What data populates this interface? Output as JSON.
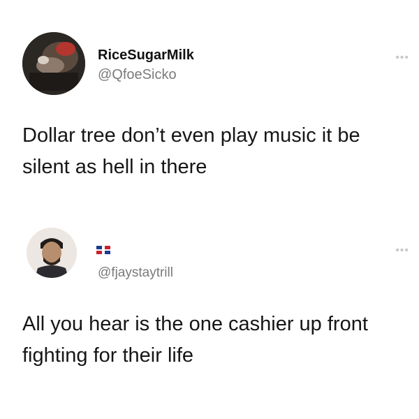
{
  "tweets": [
    {
      "display_name": "RiceSugarMilk",
      "handle": "@QfoeSicko",
      "text": "Dollar tree don’t even play music it be silent as hell in there",
      "more_icon": "more-dots-icon"
    },
    {
      "display_name": "",
      "flag_icon": "flag-icon",
      "handle": "@fjaystaytrill",
      "text": "All you hear is the one cashier up front fighting for their life",
      "more_icon": "more-dots-icon"
    }
  ],
  "colors": {
    "text": "#161616",
    "handle": "#7a7a7a",
    "more": "#c9c9c9",
    "background": "#ffffff"
  }
}
